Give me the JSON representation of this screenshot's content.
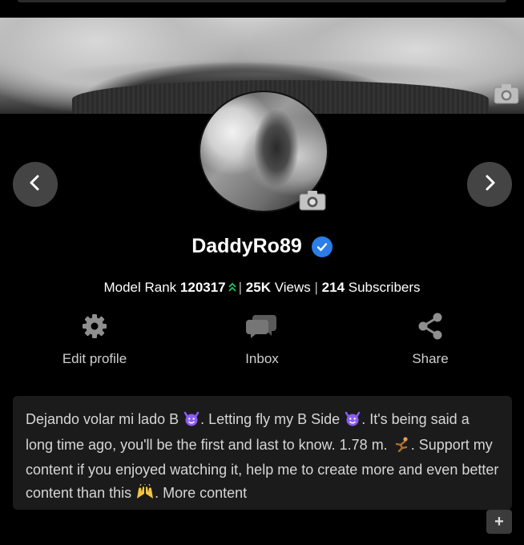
{
  "profile": {
    "username": "DaddyRo89",
    "verified": true
  },
  "stats": {
    "rank_label": "Model Rank",
    "rank_value": "120317",
    "views_value": "25K",
    "views_label": "Views",
    "subscribers_value": "214",
    "subscribers_label": "Subscribers",
    "separator": "|"
  },
  "actions": {
    "edit_label": "Edit profile",
    "inbox_label": "Inbox",
    "share_label": "Share"
  },
  "bio": {
    "part1": "Dejando volar mi lado B ",
    "part2": ". Letting fly my B Side ",
    "part3": ". It's being said a long time ago, you'll be the first and last to know. 1.78 m. ",
    "part4": ". Support my content if you enjoyed watching it, help me to create more and even better content than this ",
    "part5": ". More content"
  },
  "expand": {
    "label": "+"
  },
  "icons": {
    "camera": "camera-icon",
    "prev": "chevron-left-icon",
    "next": "chevron-right-icon",
    "verified": "verified-check-icon",
    "rank_up": "double-chevron-up-icon",
    "edit": "gear-icon",
    "inbox": "chat-bubbles-icon",
    "share": "share-icon",
    "emoji_devil": "smiling-devil-emoji",
    "emoji_runner": "running-figure-emoji",
    "emoji_hands": "raised-hands-emoji"
  },
  "colors": {
    "background": "#000000",
    "bio_background": "#1b1b1b",
    "verified": "#2b7de9",
    "rank_up": "#22c55e",
    "devil_emoji": "#8b5cf6"
  }
}
